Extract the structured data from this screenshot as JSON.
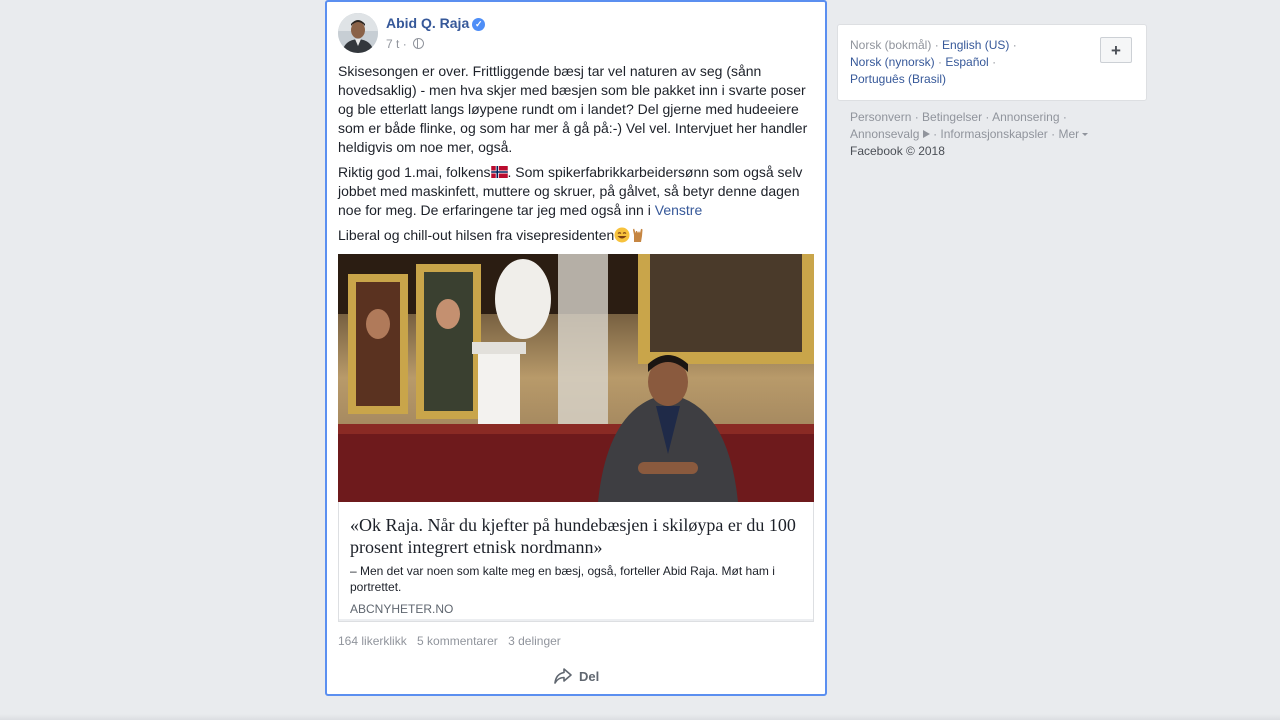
{
  "post": {
    "author": "Abid Q. Raja",
    "timestamp": "7 t",
    "separator": "·",
    "paragraphs": {
      "p1": "Skisesongen er over. Frittliggende bæsj tar vel naturen av seg (sånn hovedsaklig) - men hva skjer med bæsjen som ble pakket inn i svarte poser og ble etterlatt langs løypene rundt om i landet? Del gjerne med hudeeiere som er både flinke, og som har mer å gå på:-) Vel vel. Intervjuet her handler heldigvis om noe mer, også.",
      "p2_a": "Riktig god 1.mai, folkens",
      "p2_b": ". Som spikerfabrikkarbeidersønn som også selv jobbet med maskinfett, muttere og skruer, på gålvet, så betyr denne dagen noe for meg. De erfaringene tar jeg med også inn i ",
      "p2_link": "Venstre",
      "p3": "Liberal og chill-out hilsen fra visepresidenten"
    },
    "link": {
      "title": "«Ok Raja. Når du kjefter på hundebæsjen i skiløypa er du 100 prosent integrert etnisk nordmann»",
      "description": "– Men det var noen som kalte meg en bæsj, også, forteller Abid Raja. Møt ham i portrettet.",
      "domain": "ABCNYHETER.NO"
    },
    "stats": {
      "likes": "164 likerklikk",
      "comments": "5 kommentarer",
      "shares": "3 delinger"
    },
    "share_label": "Del",
    "icons": {
      "verified": "verified-badge-icon",
      "privacy": "globe-icon",
      "share": "share-arrow-icon",
      "flag": "norway-flag-icon",
      "emoji_1": "grinning-face-icon",
      "emoji_2": "rock-hand-icon"
    }
  },
  "languages": {
    "current": "Norsk (bokmål)",
    "options": [
      "English (US)",
      "Norsk (nynorsk)",
      "Español",
      "Português (Brasil)"
    ],
    "add_label": "+"
  },
  "footer": {
    "links": [
      "Personvern",
      "Betingelser",
      "Annonsering",
      "Annonsevalg",
      "Informasjonskapsler",
      "Mer"
    ],
    "copyright": "Facebook © 2018"
  },
  "colors": {
    "background": "#e9ebee",
    "link": "#365899",
    "focus_border": "#5b8ff0",
    "muted": "#90949c"
  }
}
